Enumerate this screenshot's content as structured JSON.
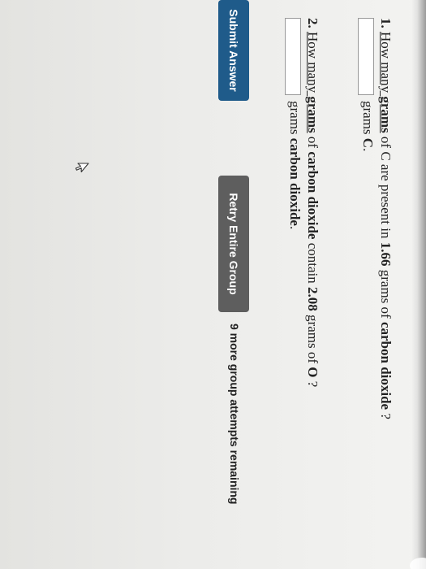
{
  "question1": {
    "number": "1.",
    "text_parts": {
      "how_many": "How many",
      "grams_bold": "grams",
      "of_c_present": "of C are present in",
      "amount": "1.66",
      "grams_of": "grams of",
      "compound": "carbon dioxide",
      "end": "?"
    },
    "input_value": "",
    "unit_prefix": "grams",
    "unit_bold": "C",
    "unit_suffix": "."
  },
  "question2": {
    "number": "2.",
    "text_parts": {
      "how_many": "How many",
      "grams_bold": "grams",
      "of": "of",
      "compound": "carbon dioxide",
      "contain": "contain",
      "amount": "2.08",
      "grams_of": "grams of",
      "element": "O",
      "end": "?"
    },
    "input_value": "",
    "unit_prefix": "grams",
    "unit_bold": "carbon dioxide",
    "unit_suffix": "."
  },
  "buttons": {
    "submit_label": "Submit Answer",
    "retry_label": "Retry Entire Group"
  },
  "status": {
    "attempts_text": "9 more group attempts remaining"
  },
  "icons": {
    "cursor": "mouse-pointer-icon"
  },
  "colors": {
    "submit_bg": "#1f5b8a",
    "retry_bg": "#5e5e5e"
  }
}
